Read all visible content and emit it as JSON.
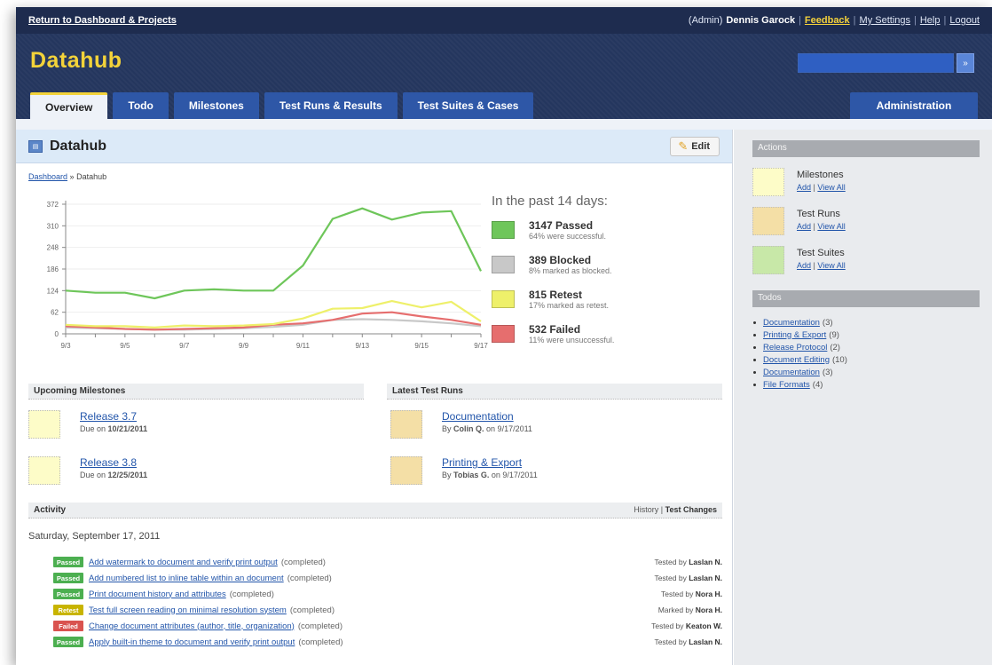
{
  "topbar": {
    "back": "Return to Dashboard & Projects",
    "role": "(Admin)",
    "user": "Dennis Garock",
    "feedback": "Feedback",
    "settings": "My Settings",
    "help": "Help",
    "logout": "Logout"
  },
  "brand": "Datahub",
  "tabs": [
    "Overview",
    "Todo",
    "Milestones",
    "Test Runs & Results",
    "Test Suites & Cases"
  ],
  "admin_tab": "Administration",
  "search": {
    "placeholder": "",
    "button": "»"
  },
  "project": {
    "icon": "project-icon",
    "title": "Datahub",
    "edit": "Edit"
  },
  "breadcrumb": {
    "link": "Dashboard",
    "sep": "»",
    "current": "Datahub"
  },
  "colors": {
    "passed": "#6ec65a",
    "blocked": "#c8c8c8",
    "retest": "#eef06a",
    "failed": "#e66e6e",
    "brand": "#f3d33a",
    "header": "#24365e"
  },
  "chart_data": {
    "type": "line",
    "x": [
      "9/3",
      "9/4",
      "9/5",
      "9/6",
      "9/7",
      "9/8",
      "9/9",
      "9/10",
      "9/11",
      "9/12",
      "9/13",
      "9/14",
      "9/15",
      "9/16",
      "9/17"
    ],
    "x_tick_labels": [
      "9/3",
      "9/5",
      "9/7",
      "9/9",
      "9/11",
      "9/13",
      "9/15",
      "9/17"
    ],
    "y_tick_labels": [
      "0",
      "62",
      "124",
      "186",
      "248",
      "310",
      "372"
    ],
    "ylim": [
      0,
      372
    ],
    "series": [
      {
        "name": "Passed",
        "color": "#6ec65a",
        "values": [
          124,
          118,
          118,
          102,
          124,
          128,
          124,
          124,
          196,
          330,
          360,
          328,
          348,
          352,
          180
        ]
      },
      {
        "name": "Retest",
        "color": "#eef06a",
        "values": [
          26,
          22,
          22,
          18,
          24,
          22,
          24,
          28,
          44,
          72,
          74,
          94,
          76,
          92,
          36
        ]
      },
      {
        "name": "Failed",
        "color": "#e66e6e",
        "values": [
          22,
          18,
          14,
          12,
          14,
          16,
          18,
          26,
          30,
          40,
          58,
          62,
          50,
          40,
          26
        ]
      },
      {
        "name": "Blocked",
        "color": "#c8c8c8",
        "values": [
          18,
          16,
          14,
          12,
          12,
          14,
          16,
          20,
          26,
          40,
          42,
          40,
          36,
          30,
          22
        ]
      }
    ]
  },
  "stats": {
    "heading": "In the past 14 days:",
    "items": [
      {
        "key": "passed",
        "title": "3147 Passed",
        "sub": "64% were successful."
      },
      {
        "key": "blocked",
        "title": "389 Blocked",
        "sub": "8% marked as blocked."
      },
      {
        "key": "retest",
        "title": "815 Retest",
        "sub": "17% marked as retest."
      },
      {
        "key": "failed",
        "title": "532 Failed",
        "sub": "11% were unsuccessful."
      }
    ]
  },
  "milestones": {
    "heading": "Upcoming Milestones",
    "items": [
      {
        "title": "Release 3.7",
        "due_prefix": "Due on",
        "due": "10/21/2011"
      },
      {
        "title": "Release 3.8",
        "due_prefix": "Due on",
        "due": "12/25/2011"
      }
    ]
  },
  "testruns": {
    "heading": "Latest Test Runs",
    "items": [
      {
        "title": "Documentation",
        "by_prefix": "By",
        "by": "Colin Q.",
        "on": "on 9/17/2011"
      },
      {
        "title": "Printing & Export",
        "by_prefix": "By",
        "by": "Tobias G.",
        "on": "on 9/17/2011"
      }
    ]
  },
  "activity": {
    "heading": "Activity",
    "history": "History",
    "sep": "|",
    "changes": "Test Changes",
    "date": "Saturday, September 17, 2011",
    "rows": [
      {
        "status": "Passed",
        "color": "#4caf50",
        "text": "Add watermark to document and verify print output",
        "suffix": "(completed)",
        "by_prefix": "Tested by",
        "by": "Laslan N."
      },
      {
        "status": "Passed",
        "color": "#4caf50",
        "text": "Add numbered list to inline table within an document",
        "suffix": "(completed)",
        "by_prefix": "Tested by",
        "by": "Laslan N."
      },
      {
        "status": "Passed",
        "color": "#4caf50",
        "text": "Print document history and attributes",
        "suffix": "(completed)",
        "by_prefix": "Tested by",
        "by": "Nora H."
      },
      {
        "status": "Retest",
        "color": "#c8b400",
        "text": "Test full screen reading on minimal resolution system",
        "suffix": "(completed)",
        "by_prefix": "Marked by",
        "by": "Nora H."
      },
      {
        "status": "Failed",
        "color": "#d9534f",
        "text": "Change document attributes (author, title, organization)",
        "suffix": "(completed)",
        "by_prefix": "Tested by",
        "by": "Keaton W."
      },
      {
        "status": "Passed",
        "color": "#4caf50",
        "text": "Apply built-in theme to document and verify print output",
        "suffix": "(completed)",
        "by_prefix": "Tested by",
        "by": "Laslan N."
      }
    ]
  },
  "sidebar": {
    "actions_heading": "Actions",
    "actions": [
      {
        "name": "Milestones",
        "color": "#fdfcc8",
        "add": "Add",
        "sep": "|",
        "view": "View All"
      },
      {
        "name": "Test Runs",
        "color": "#f4dfa6",
        "add": "Add",
        "sep": "|",
        "view": "View All"
      },
      {
        "name": "Test Suites",
        "color": "#c8e8a8",
        "add": "Add",
        "sep": "|",
        "view": "View All"
      }
    ],
    "todos_heading": "Todos",
    "todos": [
      {
        "label": "Documentation",
        "count": "(3)"
      },
      {
        "label": "Printing & Export",
        "count": "(9)"
      },
      {
        "label": "Release Protocol",
        "count": "(2)"
      },
      {
        "label": "Document Editing",
        "count": "(10)"
      },
      {
        "label": "Documentation",
        "count": "(3)"
      },
      {
        "label": "File Formats",
        "count": "(4)"
      }
    ]
  }
}
